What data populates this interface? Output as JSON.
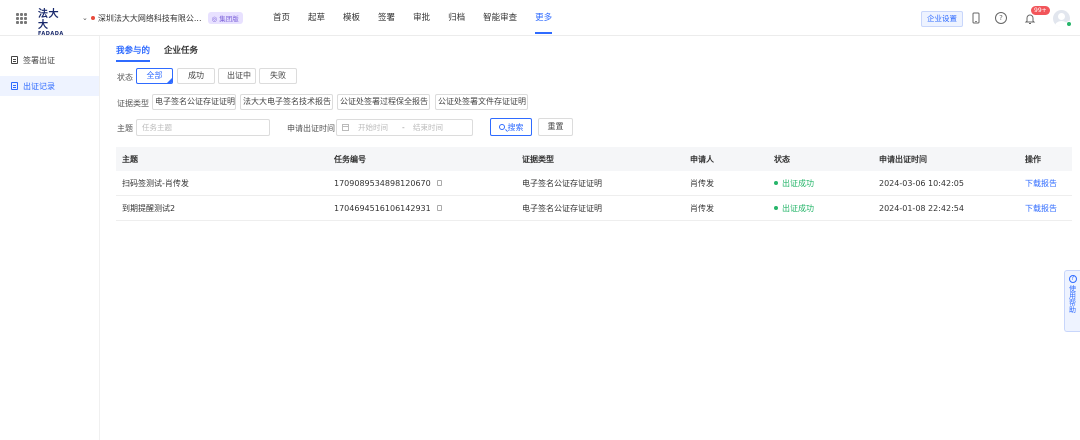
{
  "header": {
    "logo_cn": "法大大",
    "logo_en": "FADADA",
    "org_name": "深圳法大大网络科技有限公...",
    "org_badge": "◎ 集团版",
    "nav": [
      "首页",
      "起草",
      "模板",
      "签署",
      "审批",
      "归档",
      "智能审查",
      "更多"
    ],
    "active_nav_index": 7,
    "enterprise_settings": "企业设置",
    "notification_count": "99+"
  },
  "sidebar": {
    "items": [
      {
        "label": "签署出证",
        "active": false
      },
      {
        "label": "出证记录",
        "active": true
      }
    ]
  },
  "tabs": [
    {
      "label": "我参与的",
      "active": true
    },
    {
      "label": "企业任务",
      "active": false
    }
  ],
  "filters": {
    "status_label": "状态",
    "status_options": [
      "全部",
      "成功",
      "出证中",
      "失败"
    ],
    "status_selected": "全部",
    "type_label": "证据类型",
    "type_options": [
      "电子签名公证存证证明",
      "法大大电子签名技术报告",
      "公证处签署过程保全报告",
      "公证处签署文件存证证明"
    ],
    "subject_label": "主题",
    "subject_placeholder": "任务主题",
    "time_label": "申请出证时间",
    "start_placeholder": "开始时间",
    "range_sep": "-",
    "end_placeholder": "结束时间",
    "search_button": "搜索",
    "reset_button": "重置"
  },
  "table": {
    "columns": [
      "主题",
      "任务编号",
      "证据类型",
      "申请人",
      "状态",
      "申请出证时间",
      "操作"
    ],
    "rows": [
      {
        "subject": "扫码签测试-肖传发",
        "task_no": "1709089534898120670",
        "evidence_type": "电子签名公证存证证明",
        "applicant": "肖传发",
        "status": "出证成功",
        "apply_time": "2024-03-06 10:42:05",
        "action": "下载报告"
      },
      {
        "subject": "到期提醒测试2",
        "task_no": "1704694516106142931",
        "evidence_type": "电子签名公证存证证明",
        "applicant": "肖传发",
        "status": "出证成功",
        "apply_time": "2024-01-08 22:42:54",
        "action": "下载报告"
      }
    ]
  },
  "help_float": {
    "icon": "?",
    "label": "使用帮助"
  },
  "colors": {
    "accent": "#2f6bff",
    "success": "#26b56a",
    "badge": "#f2555a"
  }
}
